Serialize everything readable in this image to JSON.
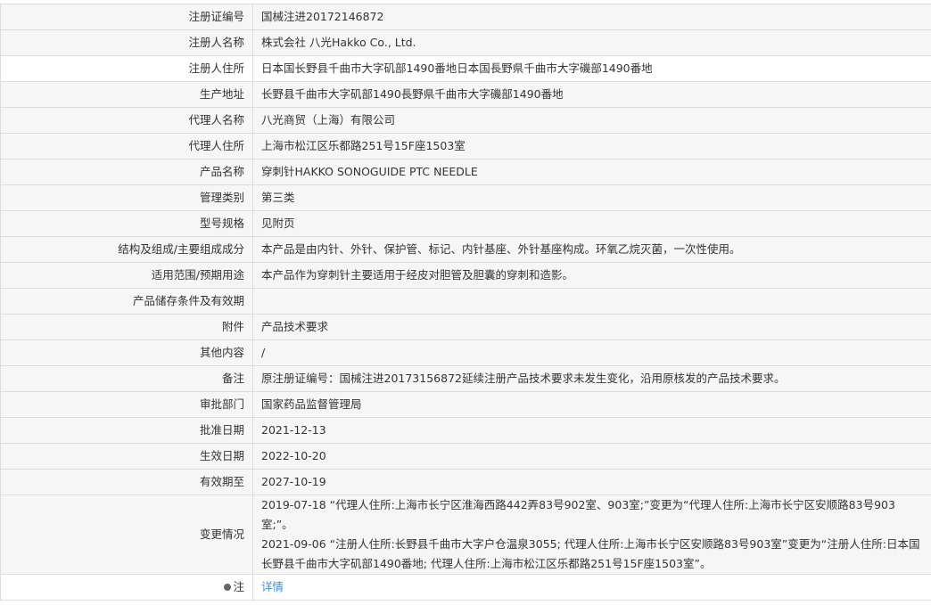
{
  "rows": [
    {
      "label": "注册证编号",
      "value": "国械注进20172146872"
    },
    {
      "label": "注册人名称",
      "value": "株式会社 八光Hakko Co., Ltd."
    },
    {
      "label": "注册人住所",
      "value": "日本国长野县千曲市大字矶部1490番地日本国長野県千曲市大字磯部1490番地"
    },
    {
      "label": "生产地址",
      "value": "长野县千曲市大字矶部1490長野県千曲市大字磯部1490番地"
    },
    {
      "label": "代理人名称",
      "value": "八光商贸（上海）有限公司"
    },
    {
      "label": "代理人住所",
      "value": "上海市松江区乐都路251号15F座1503室"
    },
    {
      "label": "产品名称",
      "value": "穿刺针HAKKO SONOGUIDE PTC NEEDLE"
    },
    {
      "label": "管理类别",
      "value": "第三类"
    },
    {
      "label": "型号规格",
      "value": "见附页"
    },
    {
      "label": "结构及组成/主要组成成分",
      "value": "本产品是由内针、外针、保护管、标记、内针基座、外针基座构成。环氧乙烷灭菌，一次性使用。"
    },
    {
      "label": "适用范围/预期用途",
      "value": "本产品作为穿刺针主要适用于经皮对胆管及胆囊的穿刺和造影。"
    },
    {
      "label": "产品储存条件及有效期",
      "value": ""
    },
    {
      "label": "附件",
      "value": "产品技术要求"
    },
    {
      "label": "其他内容",
      "value": "/"
    },
    {
      "label": "备注",
      "value": "原注册证编号：国械注进20173156872延续注册产品技术要求未发生变化，沿用原核发的产品技术要求。"
    },
    {
      "label": "审批部门",
      "value": "国家药品监督管理局"
    },
    {
      "label": "批准日期",
      "value": "2021-12-13"
    },
    {
      "label": "生效日期",
      "value": "2022-10-20"
    },
    {
      "label": "有效期至",
      "value": "2027-10-19"
    }
  ],
  "changes": {
    "label": "变更情况",
    "entries": [
      "2019-07-18 “代理人住所:上海市长宁区淮海西路442弄83号902室、903室;”变更为“代理人住所:上海市长宁区安顺路83号903室;”。",
      "2021-09-06 “注册人住所:长野县千曲市大字户仓温泉3055; 代理人住所:上海市长宁区安顺路83号903室”变更为“注册人住所:日本国长野县千曲市大字矶部1490番地; 代理人住所:上海市松江区乐都路251号15F座1503室”。"
    ]
  },
  "note": {
    "label": "注",
    "link": "详情"
  }
}
